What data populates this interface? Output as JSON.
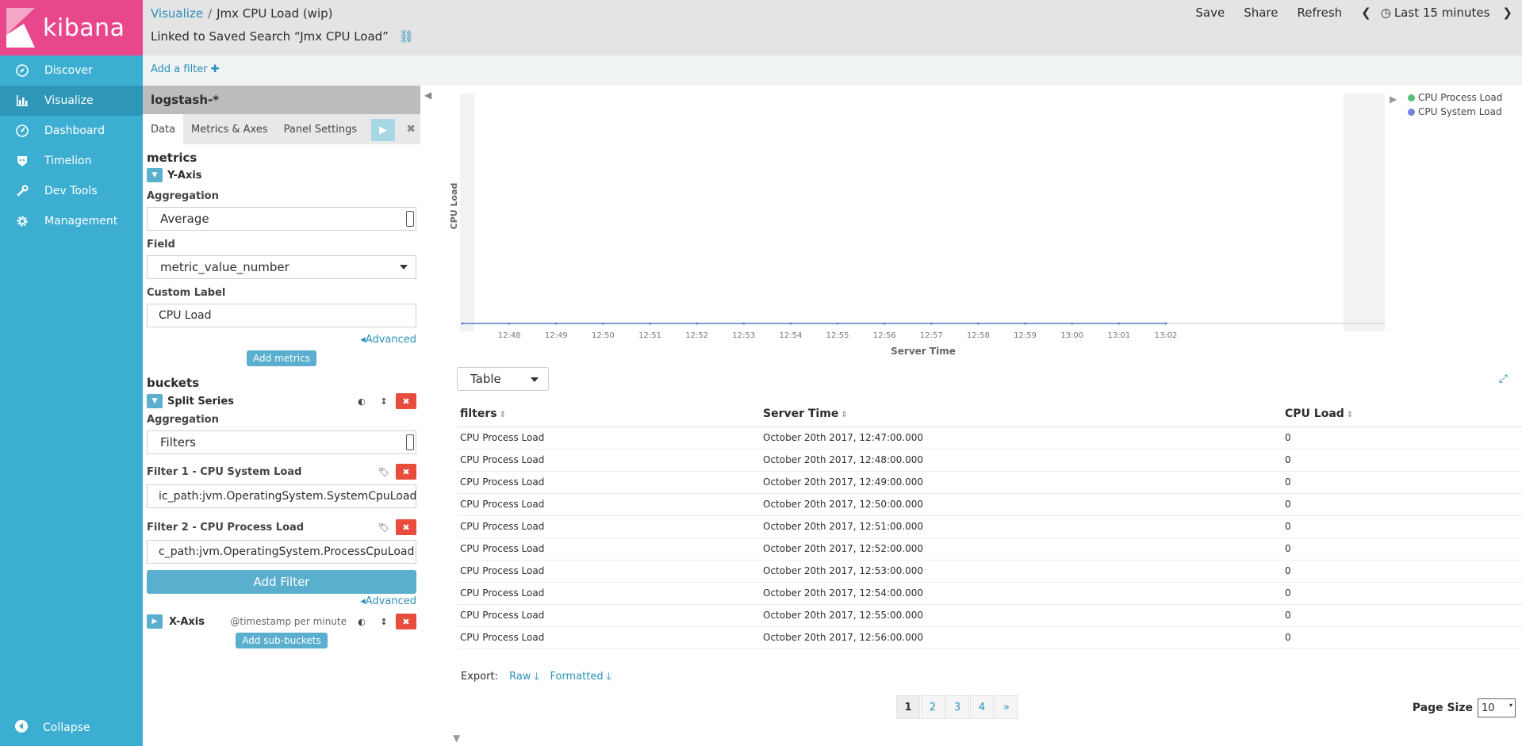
{
  "sidebar": {
    "brand": "kibana",
    "items": [
      {
        "label": "Discover",
        "icon": "compass-icon"
      },
      {
        "label": "Visualize",
        "icon": "bar-chart-icon"
      },
      {
        "label": "Dashboard",
        "icon": "dashboard-icon"
      },
      {
        "label": "Timelion",
        "icon": "timelion-icon"
      },
      {
        "label": "Dev Tools",
        "icon": "wrench-icon"
      },
      {
        "label": "Management",
        "icon": "gear-icon"
      }
    ],
    "collapse_label": "Collapse"
  },
  "header": {
    "breadcrumb_root": "Visualize",
    "breadcrumb_sep": "/",
    "title": "Jmx CPU Load (wip)",
    "linked_text": "Linked to Saved Search “Jmx CPU Load”",
    "actions": {
      "save": "Save",
      "share": "Share",
      "refresh": "Refresh",
      "time": "Last 15 minutes"
    }
  },
  "filterbar": {
    "add_filter": "Add a filter"
  },
  "editor": {
    "index": "logstash-*",
    "tabs": [
      "Data",
      "Metrics & Axes",
      "Panel Settings"
    ],
    "metrics_title": "metrics",
    "yaxis_label": "Y-Axis",
    "aggregation_label": "Aggregation",
    "aggregation_value": "Average",
    "field_label": "Field",
    "field_value": "metric_value_number",
    "custom_label_label": "Custom Label",
    "custom_label_value": "CPU Load",
    "advanced": "Advanced",
    "add_metrics": "Add metrics",
    "buckets_title": "buckets",
    "split_series": "Split Series",
    "bucket_agg_label": "Aggregation",
    "bucket_agg_value": "Filters",
    "filter1_label": "Filter 1 - CPU System Load",
    "filter1_value": "ic_path:jvm.OperatingSystem.SystemCpuLoad",
    "filter2_label": "Filter 2 - CPU Process Load",
    "filter2_value": "c_path:jvm.OperatingSystem.ProcessCpuLoad",
    "add_filter_btn": "Add Filter",
    "advanced2": "Advanced",
    "xaxis_label": "X-Axis",
    "xaxis_desc": "@timestamp per minute",
    "add_sub_buckets": "Add sub-buckets"
  },
  "legend": [
    {
      "name": "CPU Process Load",
      "color": "#57c17b"
    },
    {
      "name": "CPU System Load",
      "color": "#6f87d8"
    }
  ],
  "chart_data": {
    "type": "line",
    "xlabel": "Server Time",
    "ylabel": "CPU Load",
    "categories": [
      "12:48",
      "12:49",
      "12:50",
      "12:51",
      "12:52",
      "12:53",
      "12:54",
      "12:55",
      "12:56",
      "12:57",
      "12:58",
      "12:59",
      "13:00",
      "13:01",
      "13:02"
    ],
    "series": [
      {
        "name": "CPU Process Load",
        "values": [
          0,
          0,
          0,
          0,
          0,
          0,
          0,
          0,
          0,
          0,
          0,
          0,
          0,
          0,
          0,
          0
        ]
      },
      {
        "name": "CPU System Load",
        "values": [
          0,
          0,
          0,
          0,
          0,
          0,
          0,
          0,
          0,
          0,
          0,
          0,
          0,
          0,
          0,
          0
        ]
      }
    ]
  },
  "table": {
    "view_select": "Table",
    "headers": [
      "filters",
      "Server Time",
      "CPU Load"
    ],
    "rows": [
      [
        "CPU Process Load",
        "October 20th 2017, 12:47:00.000",
        "0"
      ],
      [
        "CPU Process Load",
        "October 20th 2017, 12:48:00.000",
        "0"
      ],
      [
        "CPU Process Load",
        "October 20th 2017, 12:49:00.000",
        "0"
      ],
      [
        "CPU Process Load",
        "October 20th 2017, 12:50:00.000",
        "0"
      ],
      [
        "CPU Process Load",
        "October 20th 2017, 12:51:00.000",
        "0"
      ],
      [
        "CPU Process Load",
        "October 20th 2017, 12:52:00.000",
        "0"
      ],
      [
        "CPU Process Load",
        "October 20th 2017, 12:53:00.000",
        "0"
      ],
      [
        "CPU Process Load",
        "October 20th 2017, 12:54:00.000",
        "0"
      ],
      [
        "CPU Process Load",
        "October 20th 2017, 12:55:00.000",
        "0"
      ],
      [
        "CPU Process Load",
        "October 20th 2017, 12:56:00.000",
        "0"
      ]
    ],
    "export_label": "Export:",
    "export_raw": "Raw",
    "export_formatted": "Formatted",
    "pages": [
      "1",
      "2",
      "3",
      "4",
      "»"
    ],
    "page_size_label": "Page Size",
    "page_size": "10"
  }
}
